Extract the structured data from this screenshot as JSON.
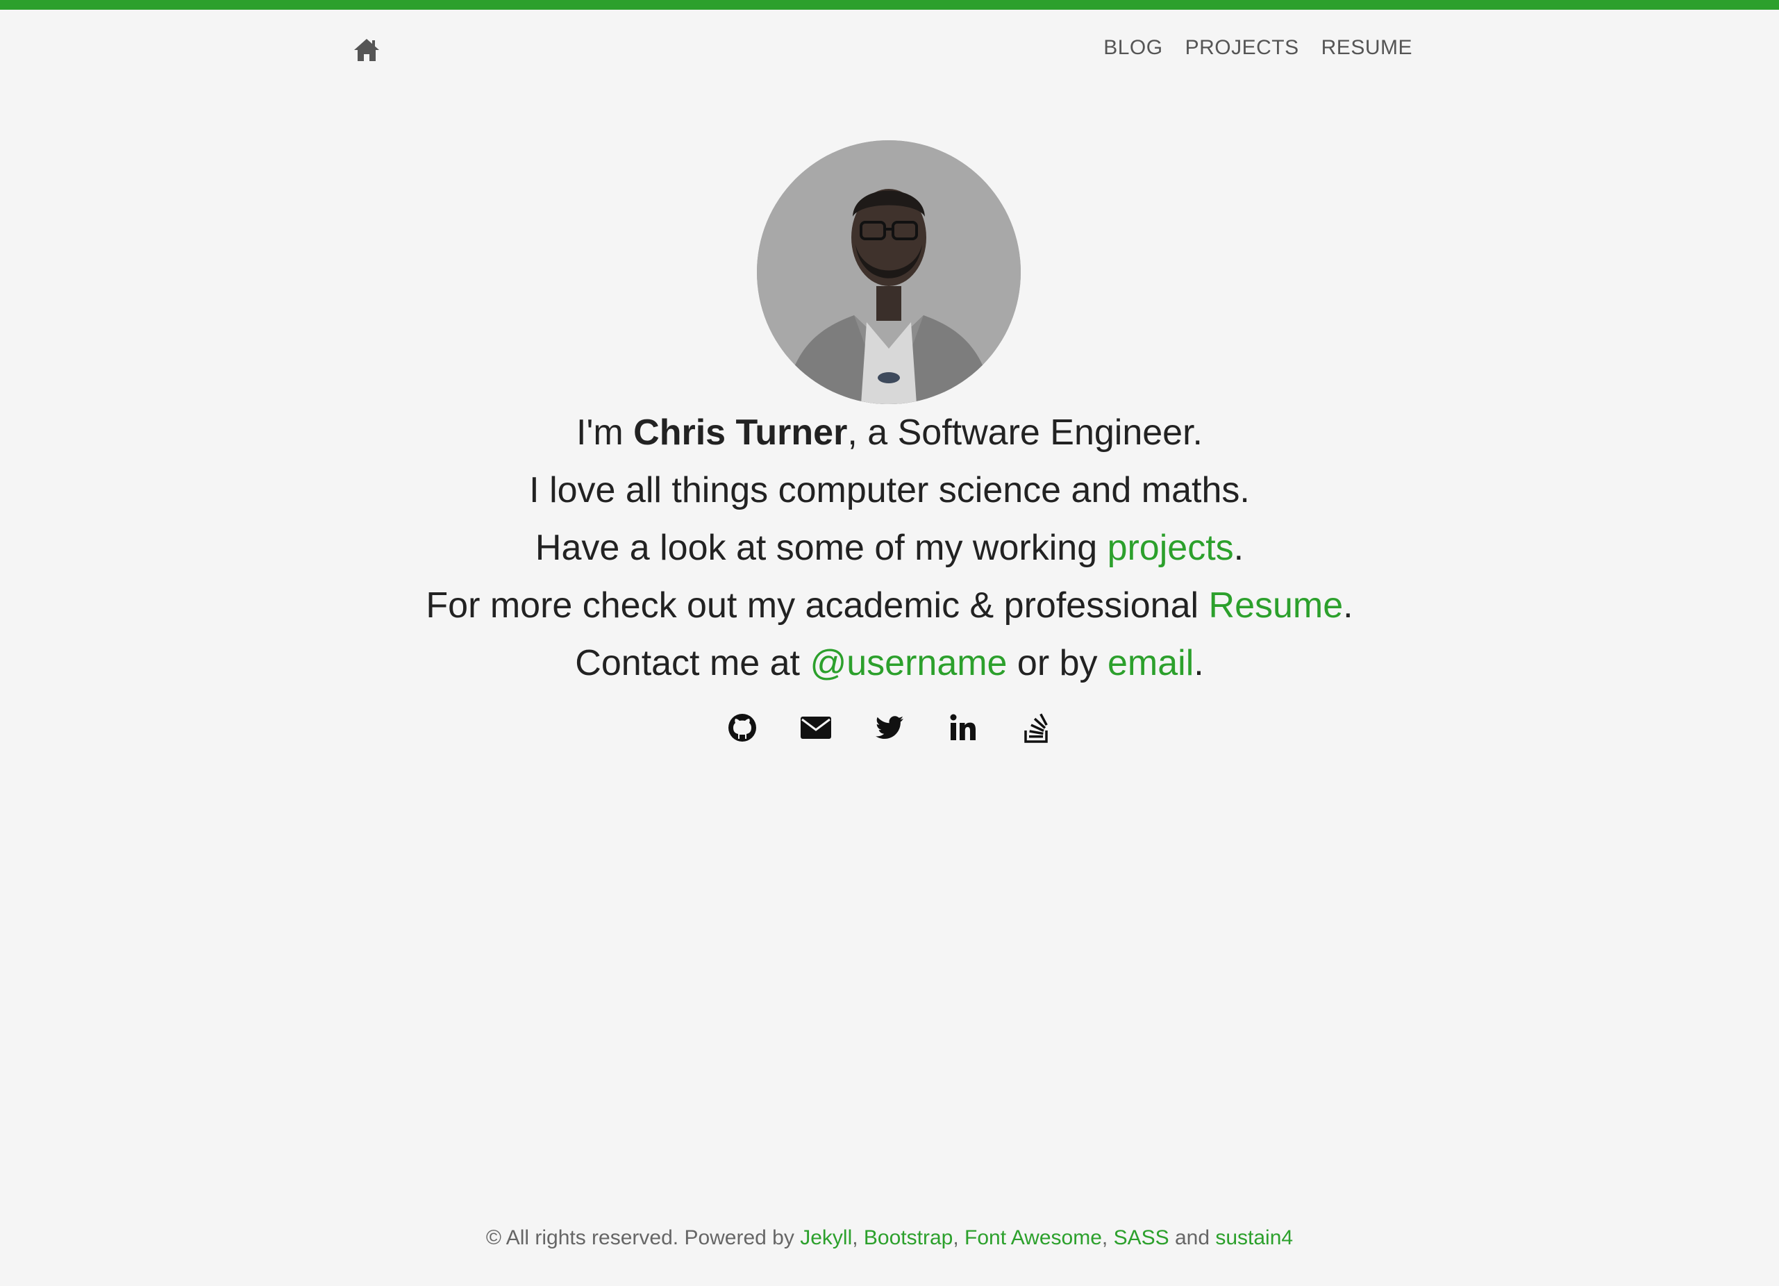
{
  "theme": {
    "accent": "#2ca02c",
    "background": "#f5f5f5",
    "text": "#222222",
    "nav_text": "#555555",
    "footer_text": "#666666"
  },
  "navbar": {
    "home_icon": "home-icon",
    "links": [
      {
        "label": "BLOG"
      },
      {
        "label": "PROJECTS"
      },
      {
        "label": "RESUME"
      }
    ]
  },
  "profile": {
    "avatar": "profile-photo"
  },
  "bio": {
    "line1": {
      "prefix": "I'm ",
      "name": "Chris Turner",
      "suffix": ", a Software Engineer."
    },
    "line2": {
      "text": "I love all things computer science and maths."
    },
    "line3": {
      "prefix": "Have a look at some of my working ",
      "link": "projects",
      "suffix": "."
    },
    "line4": {
      "prefix": "For more check out my academic & professional ",
      "link": "Resume",
      "suffix": "."
    },
    "line5": {
      "prefix": "Contact me at ",
      "link1": "@username",
      "middle": " or by ",
      "link2": "email",
      "suffix": "."
    }
  },
  "socials": [
    {
      "icon": "github-icon"
    },
    {
      "icon": "envelope-icon"
    },
    {
      "icon": "twitter-icon"
    },
    {
      "icon": "linkedin-icon"
    },
    {
      "icon": "stack-overflow-icon"
    }
  ],
  "footer": {
    "prefix": "© All rights reserved. Powered by ",
    "links": [
      "Jekyll",
      "Bootstrap",
      "Font Awesome",
      "SASS",
      "sustain4"
    ],
    "sep": ", ",
    "and": " and "
  }
}
